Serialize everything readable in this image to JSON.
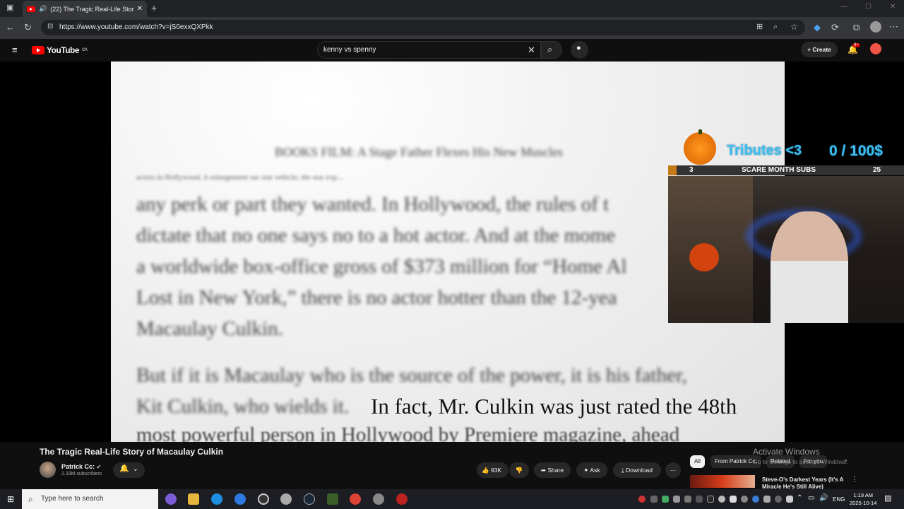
{
  "browser": {
    "tab_title": "(22) The Tragic Real-Life Stor",
    "url": "https://www.youtube.com/watch?v=jS0exxQXPkk"
  },
  "youtube": {
    "logo_text": "YouTube",
    "country": "CA",
    "search_value": "kenny vs spenny",
    "create_label": "Create",
    "notif_badge": "9+"
  },
  "video_page": {
    "blurred_header": "BOOKS  FILM: A Stage Father Flexes His New Muscles",
    "blurred_small": "actors in Hollywood, it enlargement sur star vehicle; the star exp... ",
    "line1": "any perk or part they wanted. In Hollywood, the rules of t",
    "line2": "dictate that no one says no to a hot actor. And at the mome",
    "line3": "a worldwide box-office gross of $373 million for “Home Al",
    "line4": "Lost in New York,” there is no actor hotter than the 12-yea",
    "line5": "Macaulay Culkin.",
    "line6": "But if it is Macaulay who is the source of the power, it is his father,",
    "line7": "Kit Culkin, who wields it.",
    "line8": "most powerful person in Hollywood by Premiere magazine, ahead",
    "caption": "In fact, Mr. Culkin was just rated the 48th"
  },
  "overlay": {
    "tributes": "Tributes <3",
    "sub_goal": "0  / 100$",
    "scare_left": "3",
    "scare_label": "SCARE MONTH SUBS",
    "scare_right": "25"
  },
  "video_info": {
    "title": "The Tragic Real-Life Story of Macaulay Culkin",
    "channel": "Patrick Cc:",
    "subscribers": "2.33M subscribers",
    "likes": "93K",
    "share": "Share",
    "ask": "Ask",
    "download": "Download"
  },
  "chips": [
    "All",
    "From Patrick Cc:",
    "Related",
    "For you"
  ],
  "recommended": {
    "title": "Steve-O's Darkest Years (It's A Miracle He's Still Alive)"
  },
  "watermark": {
    "line1": "Activate Windows",
    "line2": "Go to Settings to activate Windows."
  },
  "taskbar": {
    "search_placeholder": "Type here to search",
    "lang": "ENG",
    "time": "1:19 AM",
    "date": "2025-10-14"
  }
}
